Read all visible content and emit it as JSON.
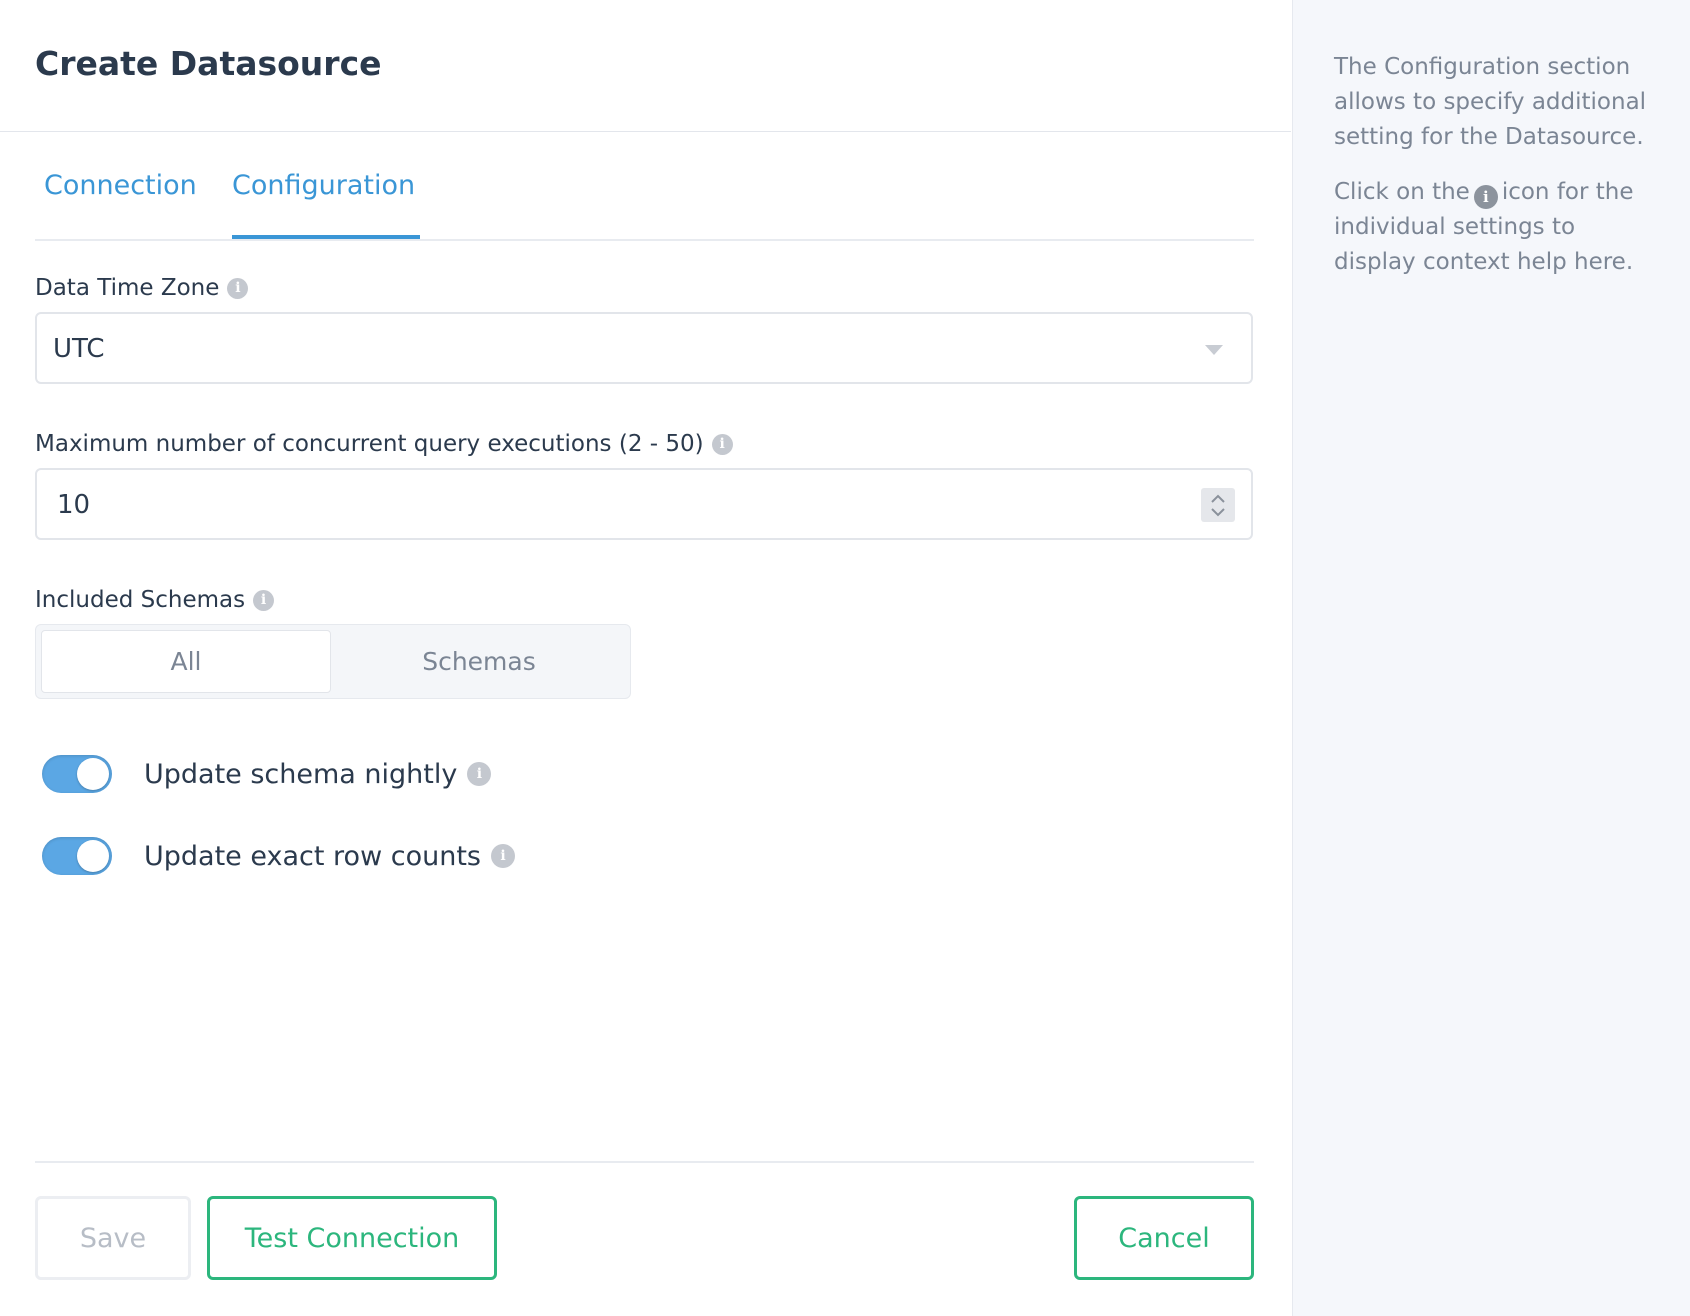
{
  "page": {
    "title": "Create Datasource"
  },
  "tabs": [
    {
      "label": "Connection",
      "active": false
    },
    {
      "label": "Configuration",
      "active": true
    }
  ],
  "fields": {
    "timezone": {
      "label": "Data Time Zone",
      "value": "UTC"
    },
    "max_concurrent": {
      "label": "Maximum number of concurrent query executions (2 - 50)",
      "value": "10"
    },
    "included_schemas": {
      "label": "Included Schemas",
      "options": [
        "All",
        "Schemas"
      ],
      "selected": "All"
    }
  },
  "toggles": [
    {
      "label": "Update schema nightly",
      "on": true
    },
    {
      "label": "Update exact row counts",
      "on": true
    }
  ],
  "buttons": {
    "save": "Save",
    "test": "Test Connection",
    "cancel": "Cancel"
  },
  "help": {
    "paragraph1": "The Configuration section allows to specify additional setting for the Datasource.",
    "paragraph2_before": "Click on the",
    "paragraph2_after": "icon for the individual settings to display context help here."
  },
  "icons": {
    "info": "info-icon",
    "dropdown": "chevron-down-icon",
    "stepper": "stepper-icon"
  },
  "colors": {
    "accent": "#3a96d6",
    "success": "#2cb67d",
    "toggle_on": "#5ba7e4"
  }
}
